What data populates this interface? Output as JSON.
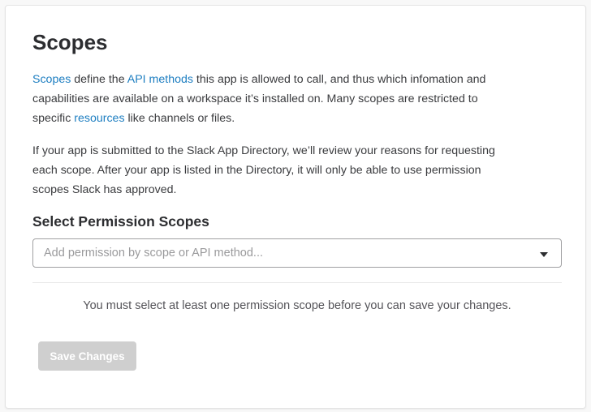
{
  "title": "Scopes",
  "intro": {
    "link_scopes": "Scopes",
    "t1": " define the ",
    "link_api_methods": "API methods",
    "t2": " this app is allowed to call, and thus which infomation and",
    "line2": "capabilities are available on a workspace it’s installed on. Many scopes are restricted to",
    "t3": "specific ",
    "link_resources": "resources",
    "t4": " like channels or files."
  },
  "review": {
    "line1": "If your app is submitted to the Slack App Directory, we’ll review your reasons for requesting",
    "line2": "each scope. After your app is listed in the Directory, it will only be able to use permission",
    "line3": "scopes Slack has approved."
  },
  "select_section": {
    "heading": "Select Permission Scopes",
    "placeholder": "Add permission by scope or API method..."
  },
  "notice": "You must select at least one permission scope before you can save your changes.",
  "save_button": "Save Changes",
  "colors": {
    "link": "#1d7ec1",
    "button_disabled": "#cfcfcf"
  }
}
